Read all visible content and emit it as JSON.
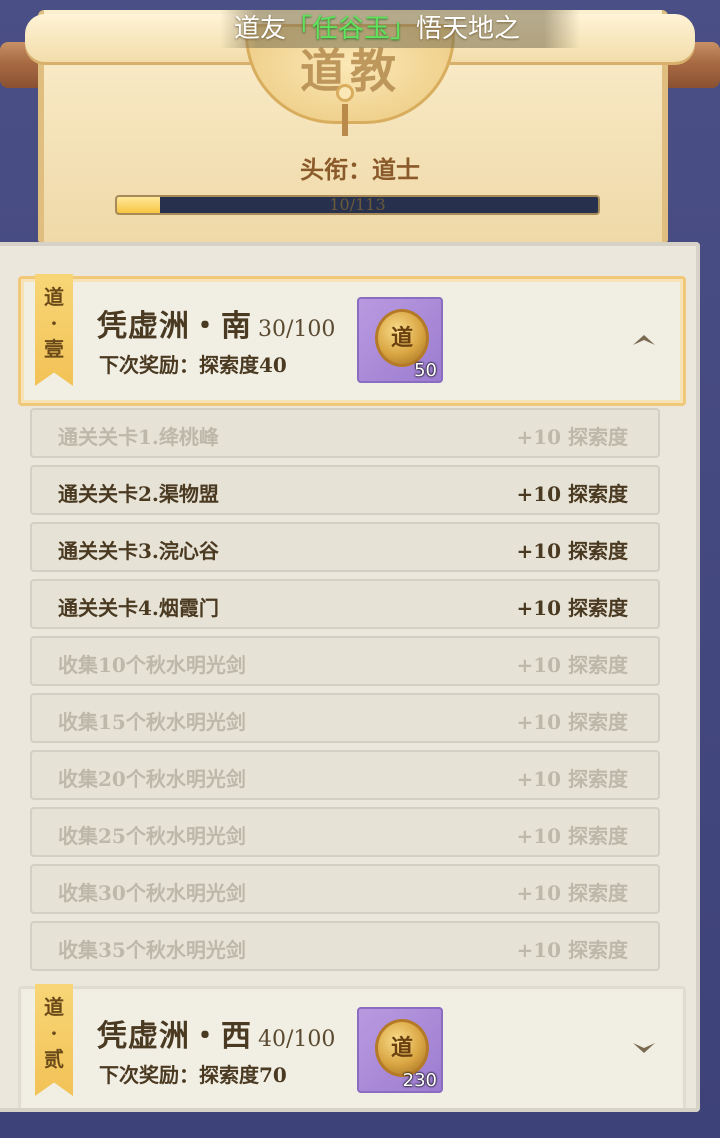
{
  "header": {
    "banner_prefix": "道友",
    "banner_name": "「任谷玉」",
    "banner_suffix": "悟天地之",
    "emblem_title": "道教",
    "rank_text": "头衔：道士",
    "progress_text": "10/113",
    "progress_value": 10,
    "progress_max": 113
  },
  "sections": [
    {
      "ribbon": "道\n·\n壹",
      "name": "凭虚洲・南",
      "count": "30/100",
      "next_reward": "下次奖励：探索度40",
      "reward_icon": "dao-coin-icon",
      "reward_glyph": "道",
      "reward_count": "50",
      "expanded": true
    },
    {
      "ribbon": "道\n·\n贰",
      "name": "凭虚洲・西",
      "count": "40/100",
      "next_reward": "下次奖励：探索度70",
      "reward_icon": "dao-coin-icon",
      "reward_glyph": "道",
      "reward_count": "230",
      "expanded": false
    }
  ],
  "tasks": [
    {
      "label": "通关关卡1.绛桃峰",
      "points": "+10 探索度",
      "active": false
    },
    {
      "label": "通关关卡2.渠物盟",
      "points": "+10 探索度",
      "active": true
    },
    {
      "label": "通关关卡3.浣心谷",
      "points": "+10 探索度",
      "active": true
    },
    {
      "label": "通关关卡4.烟霞门",
      "points": "+10 探索度",
      "active": true
    },
    {
      "label": "收集10个秋水明光剑",
      "points": "+10 探索度",
      "active": false
    },
    {
      "label": "收集15个秋水明光剑",
      "points": "+10 探索度",
      "active": false
    },
    {
      "label": "收集20个秋水明光剑",
      "points": "+10 探索度",
      "active": false
    },
    {
      "label": "收集25个秋水明光剑",
      "points": "+10 探索度",
      "active": false
    },
    {
      "label": "收集30个秋水明光剑",
      "points": "+10 探索度",
      "active": false
    },
    {
      "label": "收集35个秋水明光剑",
      "points": "+10 探索度",
      "active": false
    }
  ],
  "colors": {
    "accent_gold": "#f2c256",
    "banner_name": "#5fe35c",
    "reward_bg": "#9c7cd0",
    "text_active": "#4b3a22",
    "text_inactive": "#bdb8aa"
  }
}
